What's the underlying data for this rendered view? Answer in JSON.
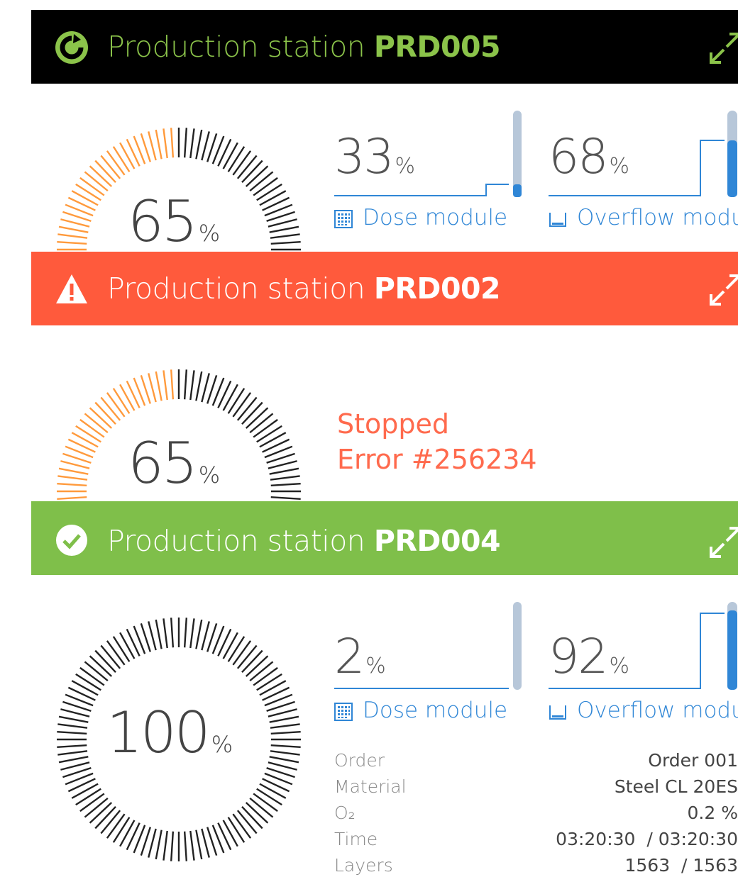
{
  "colors": {
    "header_running_bg": "#000000",
    "header_error_bg": "#ff5a3c",
    "header_ok_bg": "#7fbf4a",
    "accent_green": "#8bc34a",
    "accent_orange": "#ff9a3c",
    "accent_blue": "#2f86d6",
    "error_text": "#ff6a4d"
  },
  "stations": [
    {
      "title_prefix": "Production station",
      "title_id": "PRD005",
      "status_icon": "running-circle-icon",
      "expand_icon": "expand-arrows-icon",
      "progress": {
        "value": "65",
        "unit": "%"
      },
      "dose": {
        "value": "33",
        "unit": "%",
        "label": "Dose module",
        "icon": "grid-icon",
        "level": 0.1
      },
      "overflow": {
        "value": "68",
        "unit": "%",
        "label": "Overflow modu",
        "icon": "tray-icon",
        "level": 0.68
      }
    },
    {
      "title_prefix": "Production station",
      "title_id": "PRD002",
      "status_icon": "warning-triangle-icon",
      "expand_icon": "expand-arrows-icon",
      "progress": {
        "value": "65",
        "unit": "%"
      },
      "status_line1": "Stopped",
      "status_line2": "Error #256234"
    },
    {
      "title_prefix": "Production station",
      "title_id": "PRD004",
      "status_icon": "check-circle-icon",
      "expand_icon": "expand-arrows-icon",
      "progress": {
        "value": "100",
        "unit": "%"
      },
      "dose": {
        "value": "2",
        "unit": "%",
        "label": "Dose module",
        "icon": "grid-icon",
        "level": 0.0
      },
      "overflow": {
        "value": "92",
        "unit": "%",
        "label": "Overflow modu",
        "icon": "tray-icon",
        "level": 0.92
      },
      "info": [
        {
          "key": "Order",
          "value": "Order 001"
        },
        {
          "key": "Material",
          "value": "Steel CL 20ES"
        },
        {
          "key": "O₂",
          "value": "0.2 %"
        },
        {
          "key": "Time",
          "value": "03:20:30  / 03:20:30"
        },
        {
          "key": "Layers",
          "value": "1563  / 1563"
        }
      ]
    }
  ]
}
